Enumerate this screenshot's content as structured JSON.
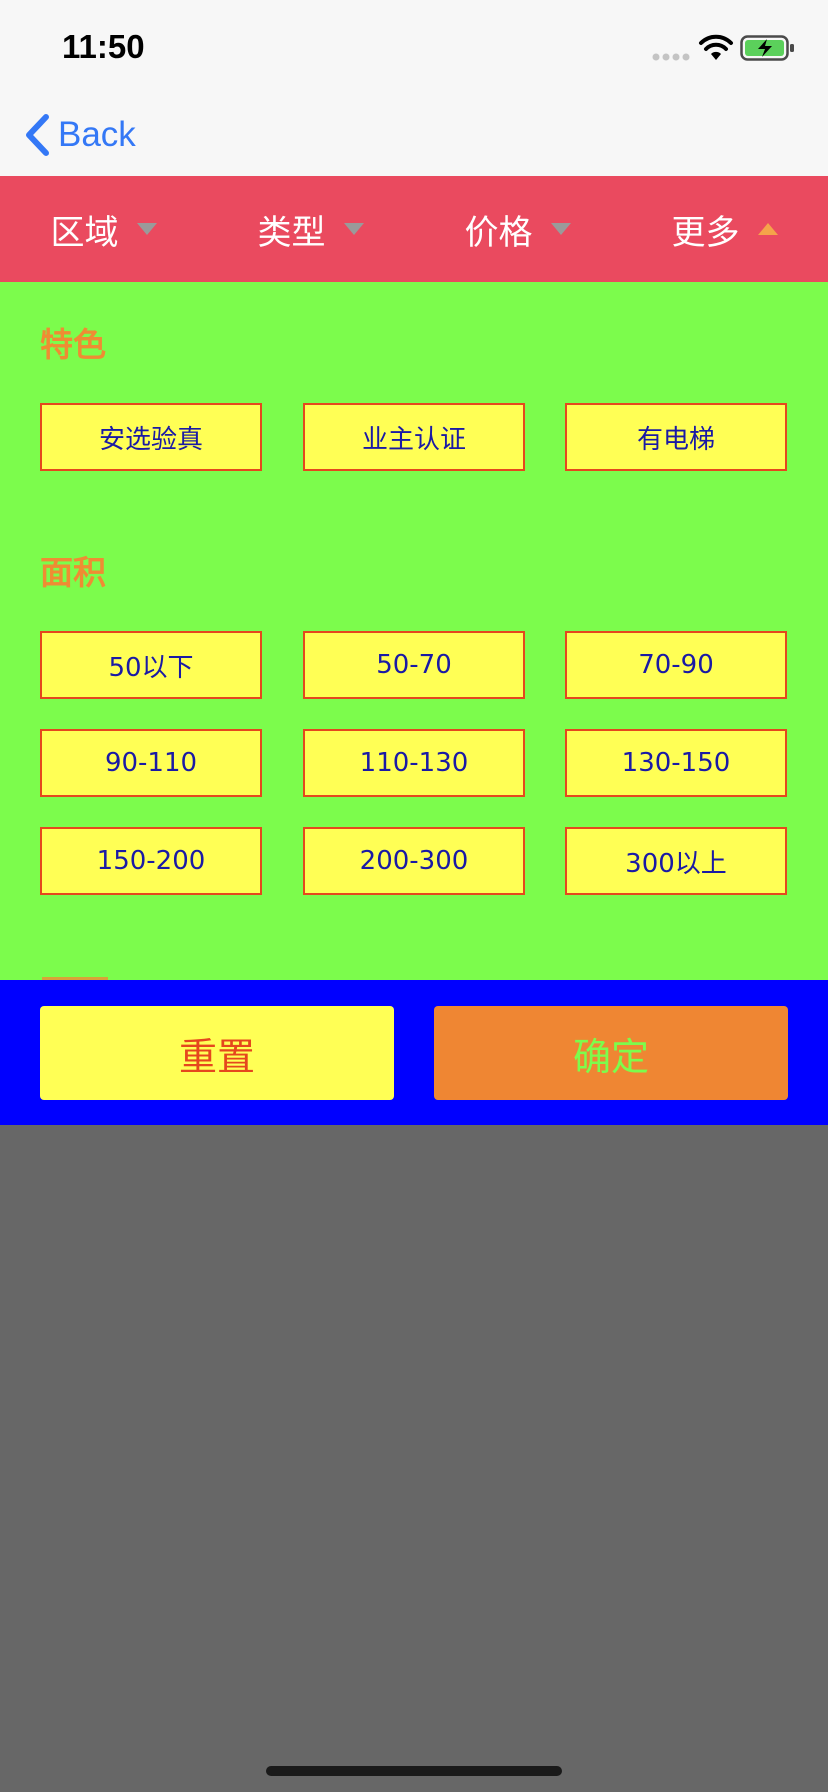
{
  "status_bar": {
    "time": "11:50",
    "icons": [
      "signal-icon",
      "wifi-icon",
      "battery-charging-icon"
    ]
  },
  "nav": {
    "back_label": "Back",
    "back_icon": "chevron-left-icon"
  },
  "filter_tabs": [
    {
      "label": "区域",
      "icon": "triangle-down-icon",
      "active": false
    },
    {
      "label": "类型",
      "icon": "triangle-down-icon",
      "active": false
    },
    {
      "label": "价格",
      "icon": "triangle-down-icon",
      "active": false
    },
    {
      "label": "更多",
      "icon": "triangle-up-icon",
      "active": true
    }
  ],
  "sections": {
    "features": {
      "title": "特色",
      "options": [
        "安选验真",
        "业主认证",
        "有电梯"
      ]
    },
    "area": {
      "title": "面积",
      "options": [
        "50以下",
        "50-70",
        "70-90",
        "90-110",
        "110-130",
        "130-150",
        "150-200",
        "200-300",
        "300以上"
      ]
    }
  },
  "actions": {
    "reset_label": "重置",
    "confirm_label": "确定"
  },
  "colors": {
    "tab_bar": "#ea4a5f",
    "panel": "#7cfc4c",
    "chip_fill": "#ffff55",
    "chip_border": "#e5471d",
    "chip_text": "#1a1aa5",
    "section_title": "#ef8c33",
    "action_bar": "#0000ff",
    "confirm_fill": "#ef8633",
    "overlay": "#676767",
    "ios_blue": "#3478f6"
  }
}
